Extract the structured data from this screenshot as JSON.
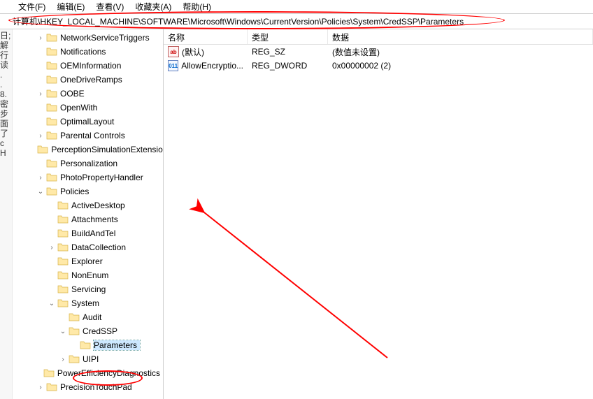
{
  "menu": {
    "file": "文件(F)",
    "edit": "编辑(E)",
    "view": "查看(V)",
    "favorites": "收藏夹(A)",
    "help": "帮助(H)"
  },
  "address": {
    "path": "计算机\\HKEY_LOCAL_MACHINE\\SOFTWARE\\Microsoft\\Windows\\CurrentVersion\\Policies\\System\\CredSSP\\Parameters"
  },
  "leftstrip": [
    "日;",
    "",
    "解",
    "行",
    "读",
    "",
    ".",
    ".",
    "8.",
    "",
    "密",
    "",
    "步",
    "面",
    "了",
    "",
    "",
    "",
    "c",
    "H"
  ],
  "tree": [
    {
      "indent": 2,
      "exp": ">",
      "label": "NetworkServiceTriggers"
    },
    {
      "indent": 2,
      "exp": "",
      "label": "Notifications"
    },
    {
      "indent": 2,
      "exp": "",
      "label": "OEMInformation"
    },
    {
      "indent": 2,
      "exp": "",
      "label": "OneDriveRamps"
    },
    {
      "indent": 2,
      "exp": ">",
      "label": "OOBE"
    },
    {
      "indent": 2,
      "exp": "",
      "label": "OpenWith"
    },
    {
      "indent": 2,
      "exp": "",
      "label": "OptimalLayout"
    },
    {
      "indent": 2,
      "exp": ">",
      "label": "Parental Controls"
    },
    {
      "indent": 2,
      "exp": "",
      "label": "PerceptionSimulationExtensions"
    },
    {
      "indent": 2,
      "exp": "",
      "label": "Personalization"
    },
    {
      "indent": 2,
      "exp": ">",
      "label": "PhotoPropertyHandler"
    },
    {
      "indent": 2,
      "exp": "v",
      "label": "Policies"
    },
    {
      "indent": 3,
      "exp": "",
      "label": "ActiveDesktop"
    },
    {
      "indent": 3,
      "exp": "",
      "label": "Attachments"
    },
    {
      "indent": 3,
      "exp": "",
      "label": "BuildAndTel"
    },
    {
      "indent": 3,
      "exp": ">",
      "label": "DataCollection"
    },
    {
      "indent": 3,
      "exp": "",
      "label": "Explorer"
    },
    {
      "indent": 3,
      "exp": "",
      "label": "NonEnum"
    },
    {
      "indent": 3,
      "exp": "",
      "label": "Servicing"
    },
    {
      "indent": 3,
      "exp": "v",
      "label": "System"
    },
    {
      "indent": 4,
      "exp": "",
      "label": "Audit"
    },
    {
      "indent": 4,
      "exp": "v",
      "label": "CredSSP"
    },
    {
      "indent": 5,
      "exp": "",
      "label": "Parameters",
      "selected": true
    },
    {
      "indent": 4,
      "exp": ">",
      "label": "UIPI"
    },
    {
      "indent": 2,
      "exp": "",
      "label": "PowerEfficiencyDiagnostics"
    },
    {
      "indent": 2,
      "exp": ">",
      "label": "PrecisionTouchPad"
    }
  ],
  "list": {
    "headers": {
      "name": "名称",
      "type": "类型",
      "data": "数据"
    },
    "rows": [
      {
        "icon": "str",
        "name": "(默认)",
        "type": "REG_SZ",
        "data": "(数值未设置)"
      },
      {
        "icon": "dw",
        "name": "AllowEncryptio...",
        "type": "REG_DWORD",
        "data": "0x00000002 (2)"
      }
    ]
  },
  "icons": {
    "str_text": "ab",
    "dw_text": "011"
  }
}
